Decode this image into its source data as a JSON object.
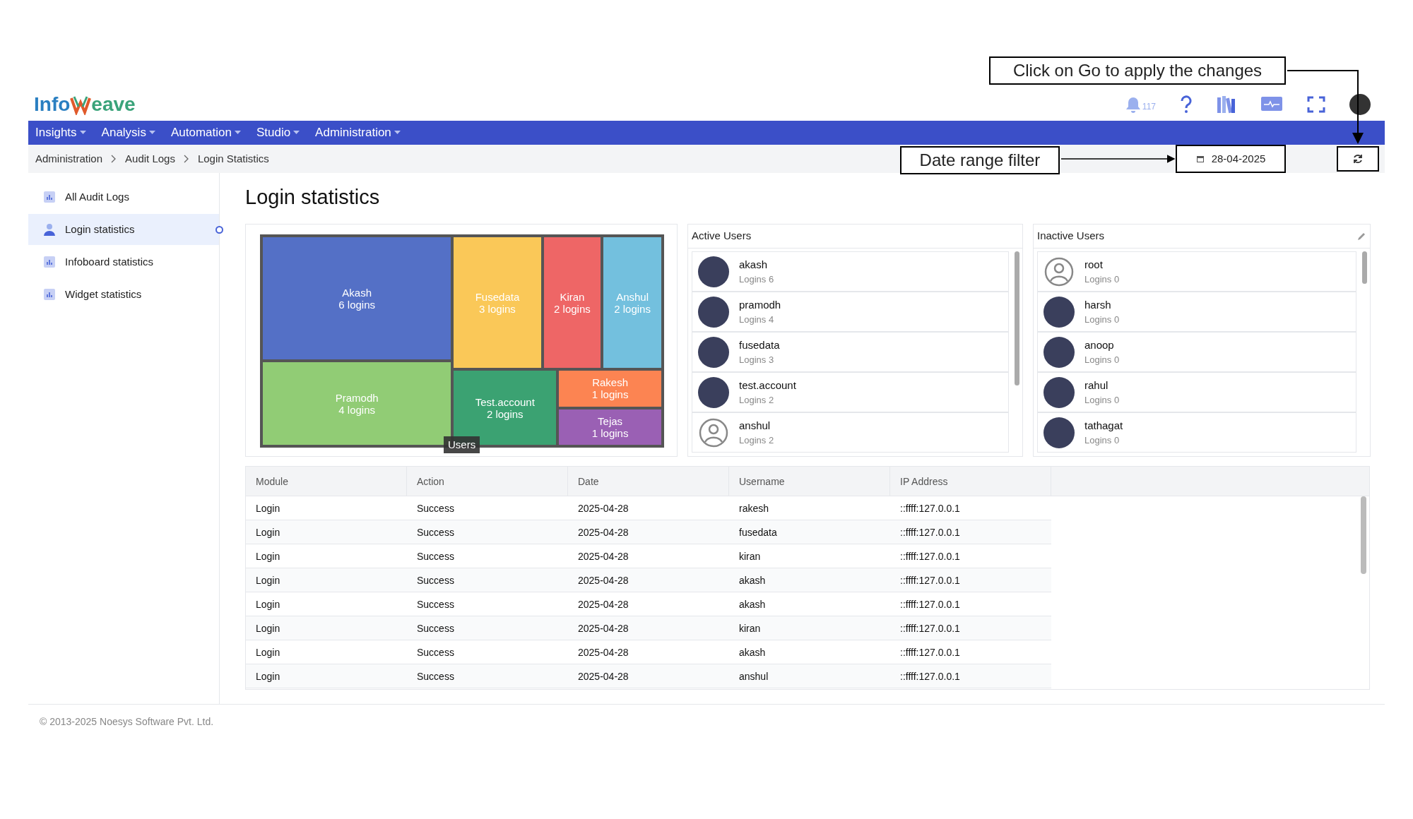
{
  "logo": {
    "left": "Info",
    "right": "eave"
  },
  "header": {
    "notification_count": "117"
  },
  "nav": [
    {
      "label": "Insights"
    },
    {
      "label": "Analysis"
    },
    {
      "label": "Automation"
    },
    {
      "label": "Studio"
    },
    {
      "label": "Administration"
    }
  ],
  "breadcrumb": [
    "Administration",
    "Audit Logs",
    "Login Statistics"
  ],
  "date_filter": "28-04-2025",
  "annotations": [
    {
      "text": "Click on Go to apply the changes"
    },
    {
      "text": "Date range filter"
    }
  ],
  "sidebar": [
    {
      "label": "All Audit Logs",
      "kind": "chart",
      "selected": false
    },
    {
      "label": "Login statistics",
      "kind": "user",
      "selected": true
    },
    {
      "label": "Infoboard statistics",
      "kind": "chart",
      "selected": false
    },
    {
      "label": "Widget statistics",
      "kind": "chart",
      "selected": false
    }
  ],
  "title": "Login statistics",
  "treemap": {
    "tooltip": "Users",
    "cells": [
      {
        "name": "Akash",
        "value": "6 logins",
        "color": "#5470c6"
      },
      {
        "name": "Fusedata",
        "value": "3 logins",
        "color": "#fac858"
      },
      {
        "name": "Kiran",
        "value": "2 logins",
        "color": "#ee6666"
      },
      {
        "name": "Anshul",
        "value": "2 logins",
        "color": "#73c0de"
      },
      {
        "name": "Pramodh",
        "value": "4 logins",
        "color": "#91cc75"
      },
      {
        "name": "Test.account",
        "value": "2 logins",
        "color": "#3ba272"
      },
      {
        "name": "Rakesh",
        "value": "1 logins",
        "color": "#fc8452"
      },
      {
        "name": "Tejas",
        "value": "1 logins",
        "color": "#9a60b4"
      }
    ]
  },
  "active_users": {
    "title": "Active Users",
    "users": [
      {
        "name": "akash",
        "logins": "Logins 6",
        "kind": "photo"
      },
      {
        "name": "pramodh",
        "logins": "Logins 4",
        "kind": "photo"
      },
      {
        "name": "fusedata",
        "logins": "Logins 3",
        "kind": "photo"
      },
      {
        "name": "test.account",
        "logins": "Logins 2",
        "kind": "photo"
      },
      {
        "name": "anshul",
        "logins": "Logins 2",
        "kind": "default"
      }
    ]
  },
  "inactive_users": {
    "title": "Inactive Users",
    "users": [
      {
        "name": "root",
        "logins": "Logins 0",
        "kind": "default"
      },
      {
        "name": "harsh",
        "logins": "Logins 0",
        "kind": "photo"
      },
      {
        "name": "anoop",
        "logins": "Logins 0",
        "kind": "photo"
      },
      {
        "name": "rahul",
        "logins": "Logins 0",
        "kind": "photo"
      },
      {
        "name": "tathagat",
        "logins": "Logins 0",
        "kind": "photo"
      }
    ]
  },
  "table": {
    "columns": [
      "Module",
      "Action",
      "Date",
      "Username",
      "IP Address"
    ],
    "rows": [
      [
        "Login",
        "Success",
        "2025-04-28",
        "rakesh",
        "::ffff:127.0.0.1"
      ],
      [
        "Login",
        "Success",
        "2025-04-28",
        "fusedata",
        "::ffff:127.0.0.1"
      ],
      [
        "Login",
        "Success",
        "2025-04-28",
        "kiran",
        "::ffff:127.0.0.1"
      ],
      [
        "Login",
        "Success",
        "2025-04-28",
        "akash",
        "::ffff:127.0.0.1"
      ],
      [
        "Login",
        "Success",
        "2025-04-28",
        "akash",
        "::ffff:127.0.0.1"
      ],
      [
        "Login",
        "Success",
        "2025-04-28",
        "kiran",
        "::ffff:127.0.0.1"
      ],
      [
        "Login",
        "Success",
        "2025-04-28",
        "akash",
        "::ffff:127.0.0.1"
      ],
      [
        "Login",
        "Success",
        "2025-04-28",
        "anshul",
        "::ffff:127.0.0.1"
      ]
    ]
  },
  "footer": "© 2013-2025 Noesys Software Pvt. Ltd."
}
